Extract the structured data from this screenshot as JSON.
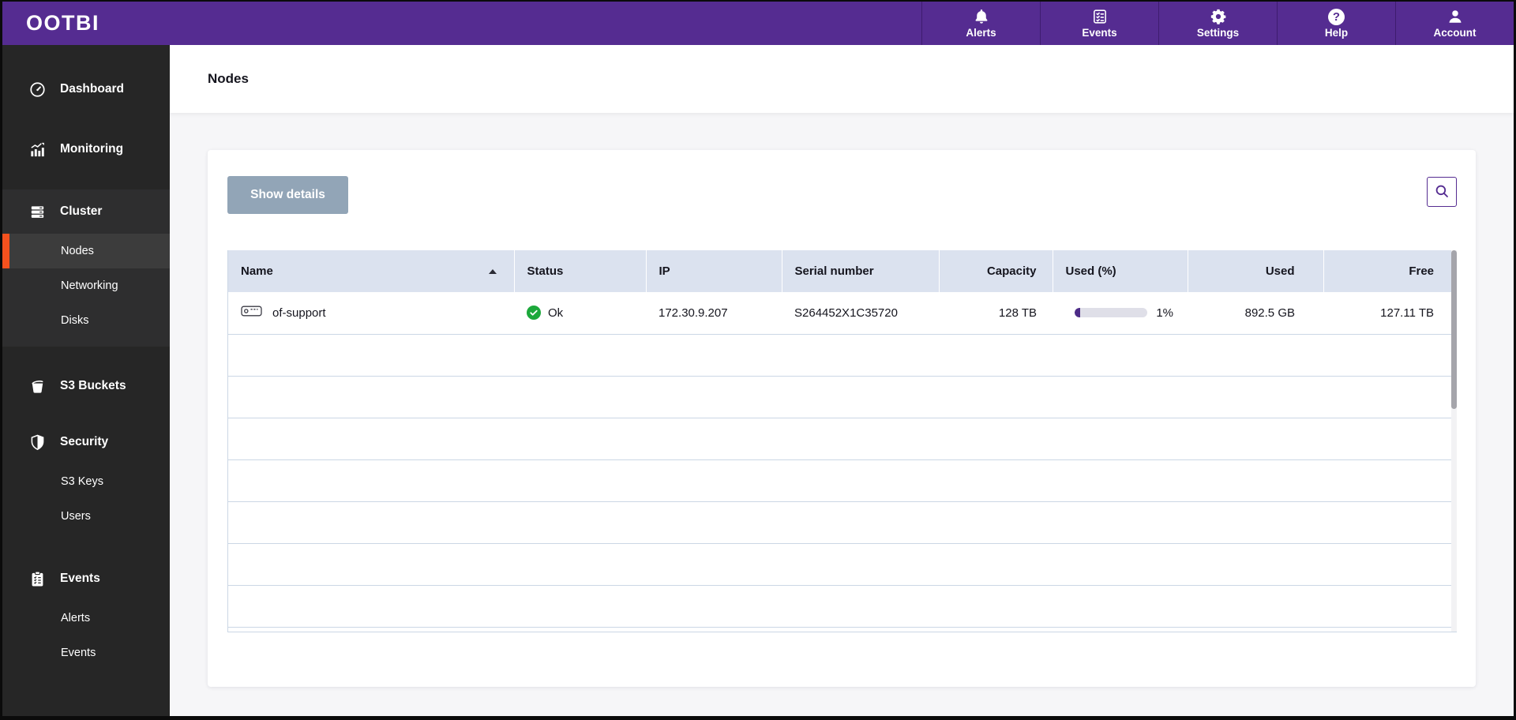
{
  "brand": {
    "logo_text": "OOTBI"
  },
  "topnav": {
    "items": [
      {
        "label": "Alerts",
        "icon": "bell-icon"
      },
      {
        "label": "Events",
        "icon": "checklist-icon"
      },
      {
        "label": "Settings",
        "icon": "gear-icon"
      },
      {
        "label": "Help",
        "icon": "help-icon"
      },
      {
        "label": "Account",
        "icon": "user-icon"
      }
    ]
  },
  "icons": {
    "help_glyph": "?"
  },
  "sidebar": {
    "dashboard_label": "Dashboard",
    "monitoring_label": "Monitoring",
    "cluster_label": "Cluster",
    "cluster_items": [
      {
        "label": "Nodes",
        "selected": true
      },
      {
        "label": "Networking",
        "selected": false
      },
      {
        "label": "Disks",
        "selected": false
      }
    ],
    "s3_buckets_label": "S3 Buckets",
    "security_label": "Security",
    "security_items": [
      {
        "label": "S3 Keys"
      },
      {
        "label": "Users"
      }
    ],
    "events_label": "Events",
    "events_items": [
      {
        "label": "Alerts"
      },
      {
        "label": "Events"
      }
    ]
  },
  "main": {
    "page_title": "Nodes",
    "toolbar": {
      "show_details_label": "Show details"
    },
    "table": {
      "columns": [
        "Name",
        "Status",
        "IP",
        "Serial number",
        "Capacity",
        "Used (%)",
        "Used",
        "Free"
      ],
      "sort": {
        "column": "Name",
        "direction": "asc"
      },
      "rows": [
        {
          "name": "of-support",
          "status": "Ok",
          "ip": "172.30.9.207",
          "serial_number": "S264452X1C35720",
          "capacity": "128 TB",
          "used_percent": "1%",
          "used_percent_value": 1,
          "used": "892.5 GB",
          "free": "127.11 TB"
        }
      ],
      "empty_rows": 7
    }
  },
  "colors": {
    "brand_purple": "#552C91",
    "accent_orange": "#F4511E",
    "status_ok_green": "#1CA83B",
    "table_header_bg": "#DBE2EF",
    "table_border": "#CBD7E5",
    "show_details_button_bg": "#92A5B7",
    "sidebar_bg": "#262626"
  }
}
